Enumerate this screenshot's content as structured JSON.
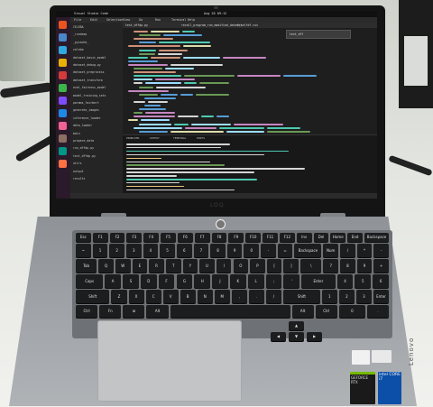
{
  "screen": {
    "window_title": "Visual Studio Code",
    "clock": "Aug 28 09:12",
    "menu": [
      "File",
      "Edit",
      "Selection",
      "View",
      "Go",
      "Run",
      "Terminal",
      "Help"
    ],
    "editor_tabs": [
      "test_dffdp.py",
      "recall_program_run_modified_dataset",
      "f_selfdf.csv"
    ],
    "search_box": "test_dff",
    "terminal_tabs": [
      "PROBLEMS",
      "OUTPUT",
      "TERMINAL",
      "PORTS"
    ],
    "explorer_items": [
      "CELEBA",
      "_rundeep",
      "_pycache_",
      "celeba",
      "dataset_basic_model",
      "dataset_debug.py",
      "dataset_preprocess",
      "dataset_transform",
      "eval_fairness_model",
      "model_training_sets",
      "params_fairbert",
      "generate_images",
      "inference_loader",
      "data_loader",
      "main",
      "prepare_data",
      "run_dffdp.py",
      "test_dffdp.py",
      "utils",
      "output",
      "results"
    ],
    "bezel_logo": "LOQ"
  },
  "keyboard": {
    "fn_row": [
      "Esc",
      "F1",
      "F2",
      "F3",
      "F4",
      "F5",
      "F6",
      "F7",
      "F8",
      "F9",
      "F10",
      "F11",
      "F12",
      "Ins",
      "Del",
      "Home",
      "End",
      "Backspace"
    ],
    "row1": [
      "~",
      "1",
      "2",
      "3",
      "4",
      "5",
      "6",
      "7",
      "8",
      "9",
      "0",
      "-",
      "=",
      "Backspace",
      "Num",
      "/",
      "*",
      "-"
    ],
    "row2": [
      "Tab",
      "Q",
      "W",
      "E",
      "R",
      "T",
      "Y",
      "U",
      "I",
      "O",
      "P",
      "[",
      "]",
      "\\",
      "7",
      "8",
      "9",
      "+"
    ],
    "row3": [
      "Caps",
      "A",
      "S",
      "D",
      "F",
      "G",
      "H",
      "J",
      "K",
      "L",
      ";",
      "'",
      "Enter",
      "4",
      "5",
      "6"
    ],
    "row4": [
      "Shift",
      "Z",
      "X",
      "C",
      "V",
      "B",
      "N",
      "M",
      ",",
      ".",
      "/",
      "Shift",
      "1",
      "2",
      "3",
      "Enter"
    ],
    "row5": [
      "Ctrl",
      "Fn",
      "⊞",
      "Alt",
      "",
      "Alt",
      "Ctrl",
      "0",
      "."
    ],
    "arrows": [
      "▲",
      "◀",
      "▼",
      "▶"
    ]
  },
  "stickers": {
    "nvidia": "GEFORCE RTX",
    "intel": "intel CORE i7"
  },
  "base_logo": "Lenovo"
}
